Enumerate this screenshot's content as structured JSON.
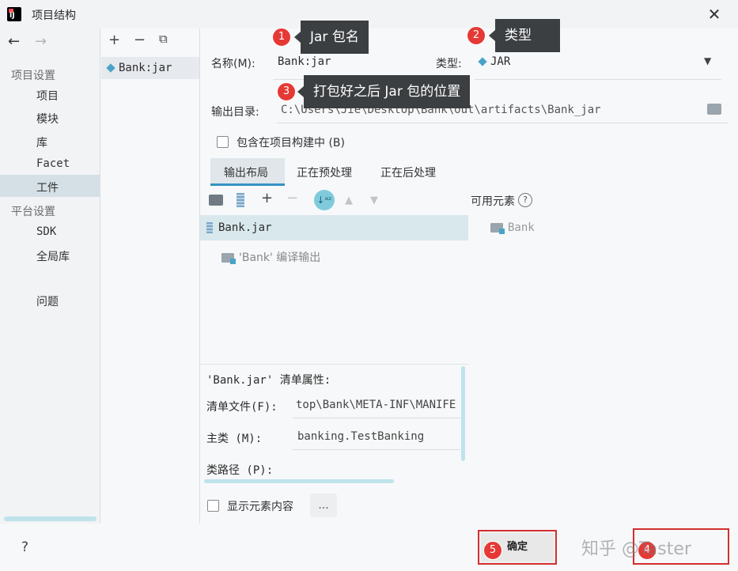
{
  "window": {
    "title": "项目结构",
    "logo_text": "IJ"
  },
  "nav": {
    "back": "←",
    "forward": "→",
    "project_settings_header": "项目设置",
    "items_project": [
      "项目",
      "模块",
      "库",
      "Facet",
      "工件"
    ],
    "platform_settings_header": "平台设置",
    "items_platform": [
      "SDK",
      "全局库"
    ],
    "problems": "问题"
  },
  "artifacts": {
    "add": "+",
    "remove": "−",
    "copy": "⧉",
    "item": "Bank:jar"
  },
  "form": {
    "name_label": "名称(M):",
    "name_value": "Bank:jar",
    "type_label": "类型:",
    "type_value": "JAR",
    "output_label": "输出目录:",
    "output_value": "C:\\Users\\Jie\\Desktop\\Bank\\out\\artifacts\\Bank_jar",
    "include_build": "包含在项目构建中 (B)"
  },
  "tabs": [
    "输出布局",
    "正在预处理",
    "正在后处理"
  ],
  "tree": {
    "root": "Bank.jar",
    "child": "'Bank' 编译输出"
  },
  "available": {
    "title": "可用元素",
    "help": "?",
    "item": "Bank"
  },
  "manifest": {
    "title": "'Bank.jar' 清单属性:",
    "file_label": "清单文件(F):",
    "file_value": "top\\Bank\\META-INF\\MANIFE",
    "main_label": "主类 (M):",
    "main_value": "banking.TestBanking",
    "classpath_label": "类路径 (P):"
  },
  "show_contents": "显示元素内容",
  "more_button": "...",
  "bottom": {
    "help": "?",
    "ok": "确定",
    "watermark": "知乎 @Taster"
  },
  "callouts": [
    {
      "num": "1",
      "text": "Jar 包名"
    },
    {
      "num": "2",
      "text": "类型"
    },
    {
      "num": "3",
      "text": "打包好之后 Jar 包的位置"
    },
    {
      "num": "5",
      "text": ""
    },
    {
      "num": "4",
      "text": ""
    }
  ],
  "colors": {
    "accent": "#3592c4",
    "selection": "#d8e8ec",
    "annotation_red": "#d32f2f"
  }
}
